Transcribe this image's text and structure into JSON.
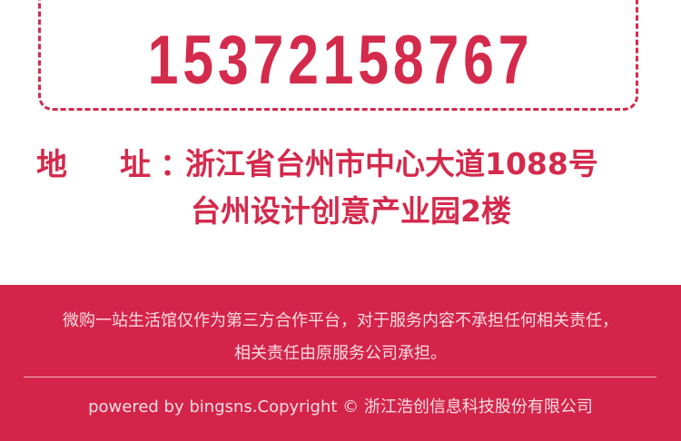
{
  "contact": {
    "phone": "15372158767"
  },
  "address": {
    "label": "地址",
    "colon": "：",
    "line1": "浙江省台州市中心大道1088号",
    "line2": "台州设计创意产业园2楼"
  },
  "footer": {
    "disclaimer_line1": "微购一站生活馆仅作为第三方合作平台，对于服务内容不承担任何相关责任，",
    "disclaimer_line2": "相关责任由原服务公司承担。",
    "copyright": "powered  by bingsns.Copyright ©  浙江浩创信息科技股份有限公司"
  },
  "colors": {
    "brand": "#d42a4c",
    "footer_bg": "#d4244a"
  }
}
